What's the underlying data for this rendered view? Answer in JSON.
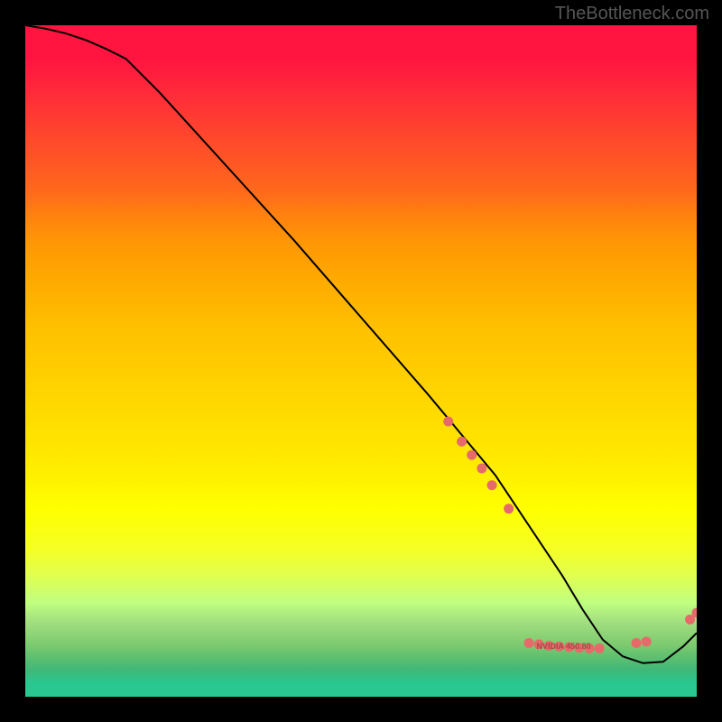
{
  "watermark": "TheBottleneck.com",
  "chart_data": {
    "type": "line",
    "title": "",
    "xlabel": "",
    "ylabel": "",
    "xlim": [
      0,
      100
    ],
    "ylim": [
      0,
      100
    ],
    "series": [
      {
        "name": "curve",
        "x": [
          0,
          3,
          6,
          9,
          12,
          15,
          20,
          30,
          40,
          50,
          60,
          65,
          70,
          75,
          80,
          83,
          86,
          89,
          92,
          95,
          98,
          100
        ],
        "values": [
          100,
          99.5,
          98.8,
          97.8,
          96.5,
          95,
          90,
          79,
          68,
          56.5,
          45,
          39,
          33,
          25.5,
          18,
          13,
          8.5,
          6,
          5,
          5.2,
          7.5,
          9.5
        ]
      }
    ],
    "markers": [
      {
        "x": 63,
        "y": 41,
        "label": ""
      },
      {
        "x": 65,
        "y": 38,
        "label": ""
      },
      {
        "x": 66.5,
        "y": 36,
        "label": ""
      },
      {
        "x": 68,
        "y": 34,
        "label": ""
      },
      {
        "x": 69.5,
        "y": 31.5,
        "label": ""
      },
      {
        "x": 72,
        "y": 28,
        "label": ""
      },
      {
        "x": 75,
        "y": 8,
        "label": ""
      },
      {
        "x": 76.5,
        "y": 7.8,
        "label": ""
      },
      {
        "x": 78,
        "y": 7.6,
        "label": ""
      },
      {
        "x": 79.5,
        "y": 7.5,
        "label": ""
      },
      {
        "x": 81,
        "y": 7.4,
        "label": ""
      },
      {
        "x": 82.5,
        "y": 7.3,
        "label": ""
      },
      {
        "x": 84,
        "y": 7.2,
        "label": ""
      },
      {
        "x": 85.5,
        "y": 7.2,
        "label": ""
      },
      {
        "x": 91,
        "y": 8.0,
        "label": ""
      },
      {
        "x": 92.5,
        "y": 8.2,
        "label": ""
      },
      {
        "x": 99,
        "y": 11.5,
        "label": ""
      },
      {
        "x": 100,
        "y": 12.5,
        "label": ""
      }
    ],
    "marker_label": "NVIDIA 450.80"
  },
  "colors": {
    "curve": "#000000",
    "marker": "#e66a6a",
    "marker_label": "#a84848"
  }
}
